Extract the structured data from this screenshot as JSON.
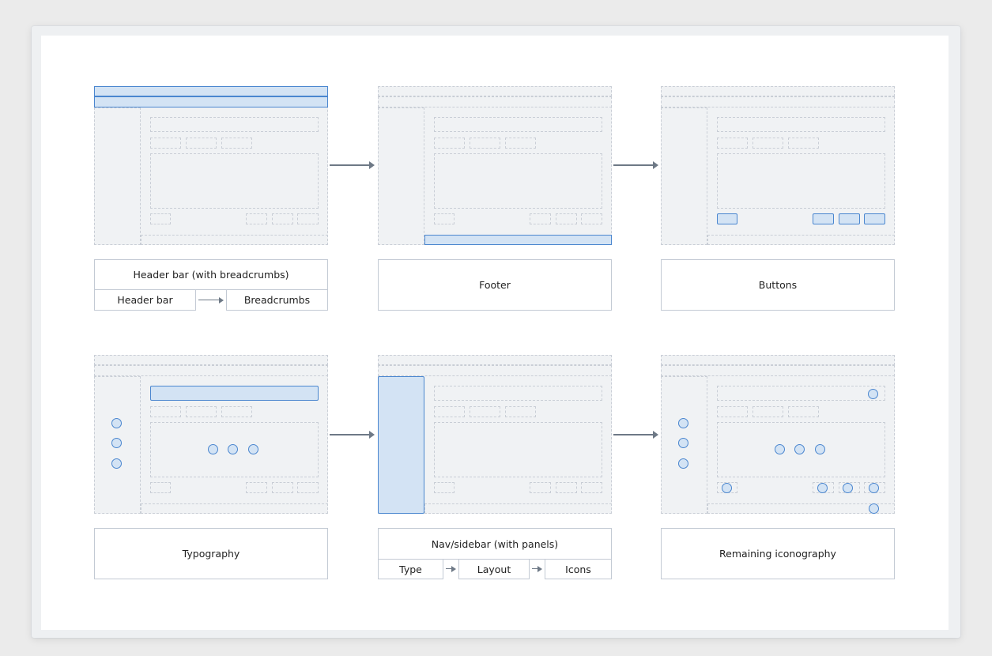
{
  "row1": {
    "header_bar_box": {
      "title": "Header bar (with breadcrumbs)",
      "left": "Header bar",
      "right": "Breadcrumbs"
    },
    "footer_box": {
      "title": "Footer"
    },
    "buttons_box": {
      "title": "Buttons"
    }
  },
  "row2": {
    "typography_box": {
      "title": "Typography"
    },
    "nav_box": {
      "title": "Nav/sidebar (with panels)",
      "left": "Type",
      "middle": "Layout",
      "right": "Icons"
    },
    "iconography_box": {
      "title": "Remaining iconography"
    }
  },
  "colors": {
    "highlight_fill": "#d3e3f4",
    "highlight_stroke": "#4a86cf",
    "placeholder_fill": "#f0f2f4",
    "placeholder_stroke": "#c9ced6",
    "arrow": "#6e7986"
  }
}
